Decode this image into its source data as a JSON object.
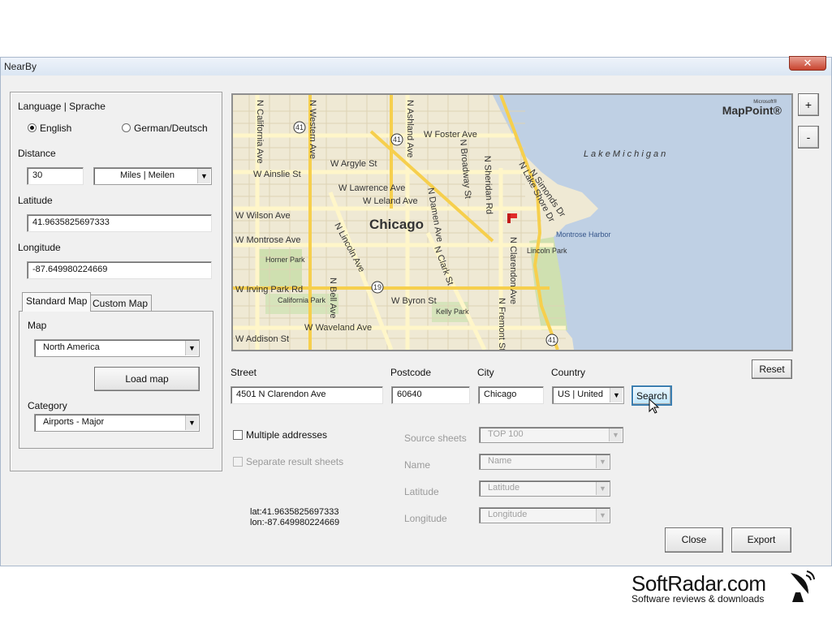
{
  "window": {
    "title": "NearBy",
    "close_glyph": "✕"
  },
  "left_panel": {
    "language_label": "Language | Sprache",
    "lang_english": "English",
    "lang_german": "German/Deutsch",
    "lang_selected": "English",
    "distance_label": "Distance",
    "distance_value": "30",
    "distance_unit": "Miles |  Meilen",
    "latitude_label": "Latitude",
    "latitude_value": "41.9635825697333",
    "longitude_label": "Longitude",
    "longitude_value": "-87.649980224669",
    "tabs": [
      "Standard Map",
      "Custom Map"
    ],
    "active_tab": "Standard Map",
    "map_label": "Map",
    "map_value": "North America",
    "load_map_button": "Load map",
    "category_label": "Category",
    "category_value": "Airports - Major"
  },
  "map_view": {
    "brand_small": "Microsoft®",
    "brand": "MapPoint®",
    "city_label": "Chicago",
    "lake_label": "L a k e   M i c h i g a n",
    "streets": [
      "N California Ave",
      "N Western Ave",
      "N Ashland Ave",
      "W Foster Ave",
      "W Argyle St",
      "W Ainslie St",
      "W Lawrence Ave",
      "W Leland Ave",
      "W Wilson Ave",
      "W Montrose Ave",
      "N Lincoln Ave",
      "N Broadway St",
      "N Sheridan Rd",
      "N Lake Shore Dr",
      "N Clarendon Ave",
      "N Damen Ave",
      "N Clark St",
      "W Irving Park Rd",
      "W Byron St",
      "W Waveland Ave",
      "W Addison St",
      "N Bell Ave",
      "N Fremont St",
      "N Simonds Dr"
    ],
    "parks": [
      "Horner Park",
      "California Park",
      "Kelly Park",
      "Lincoln Park",
      "Montrose Harbor"
    ],
    "highway_shields": [
      "41",
      "41",
      "19",
      "41"
    ],
    "zoom_in": "+",
    "zoom_out": "-"
  },
  "address": {
    "street_label": "Street",
    "street_value": "4501 N Clarendon Ave",
    "postcode_label": "Postcode",
    "postcode_value": "60640",
    "city_label": "City",
    "city_value": "Chicago",
    "country_label": "Country",
    "country_value": "US | United",
    "search_button": "Search",
    "reset_button": "Reset"
  },
  "options": {
    "multiple_addresses": "Multiple addresses",
    "separate_sheets": "Separate result sheets",
    "source_sheets_label": "Source sheets",
    "source_sheets_value": "TOP 100",
    "name_label": "Name",
    "name_value": "Name",
    "latitude_label": "Latitude",
    "latitude_value": "Latitude",
    "longitude_label": "Longitude",
    "longitude_value": "Longitude"
  },
  "result": {
    "lat_line": "lat:41.9635825697333",
    "lon_line": "lon:-87.649980224669"
  },
  "footer": {
    "close_button": "Close",
    "export_button": "Export"
  },
  "watermark": {
    "brand": "SoftRadar.com",
    "tagline": "Software reviews & downloads"
  }
}
